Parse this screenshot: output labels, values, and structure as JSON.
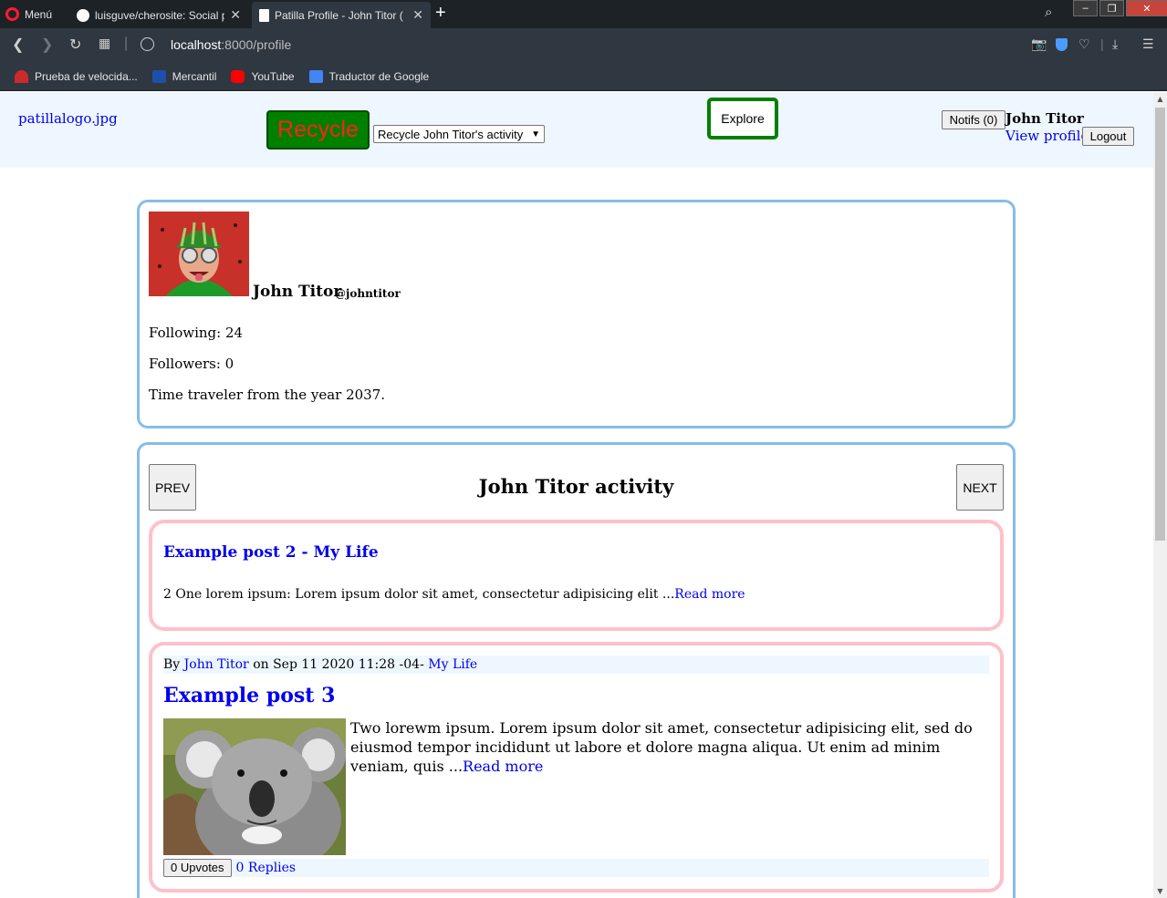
{
  "browser": {
    "menu_label": "Menú",
    "tabs": [
      {
        "title": "luisguve/cherosite: Social p",
        "active": false
      },
      {
        "title": "Patilla Profile - John Titor (",
        "active": true
      }
    ],
    "url_host": "localhost",
    "url_rest": ":8000/profile",
    "bookmarks": [
      {
        "label": "Prueba de velocida...",
        "icon": "speedtest-icon",
        "color": "#cc2b2b"
      },
      {
        "label": "Mercantil",
        "icon": "mercantil-icon",
        "color": "#1f4fa8"
      },
      {
        "label": "YouTube",
        "icon": "youtube-icon",
        "color": "#ff0000"
      },
      {
        "label": "Traductor de Google",
        "icon": "google-translate-icon",
        "color": "#4285f4"
      }
    ]
  },
  "header": {
    "logo_text": "patillalogo.jpg",
    "recycle_label": "Recycle",
    "recycle_option": "Recycle John Titor's activity",
    "explore_label": "Explore",
    "notifs_label": "Notifs (0)",
    "username": "John Titor",
    "view_profile": "View profile",
    "logout_label": "Logout"
  },
  "profile": {
    "name": "John Titor",
    "handle": "@johntitor",
    "following": "Following: 24",
    "followers": "Followers: 0",
    "bio": "Time traveler from the year 2037."
  },
  "activity": {
    "title": "John Titor activity",
    "prev_label": "PREV",
    "next_label": "NEXT",
    "posts": [
      {
        "title": "Example post 2",
        "separator": " - ",
        "section": "My Life",
        "excerpt": "2 One lorem ipsum: Lorem ipsum dolor sit amet, consectetur adipisicing elit ...",
        "read_more": "Read more"
      },
      {
        "by_prefix": "By ",
        "author": "John Titor",
        "date_text": " on Sep 11 2020 11:28 -04- ",
        "section": "My Life",
        "title": "Example post 3",
        "excerpt": "Two lorewm ipsum. Lorem ipsum dolor sit amet, consectetur adipisicing elit, sed do eiusmod tempor incididunt ut labore et dolore magna aliqua. Ut enim ad minim veniam, quis ...",
        "read_more": "Read more",
        "upvotes": "0 Upvotes",
        "replies": "0 Replies"
      }
    ]
  },
  "colors": {
    "header_bg": "#eef7ff",
    "card_border": "#86bde8",
    "post_border": "#ffc0cb",
    "accent_green": "#008000",
    "recycle_text": "#ff2020"
  }
}
